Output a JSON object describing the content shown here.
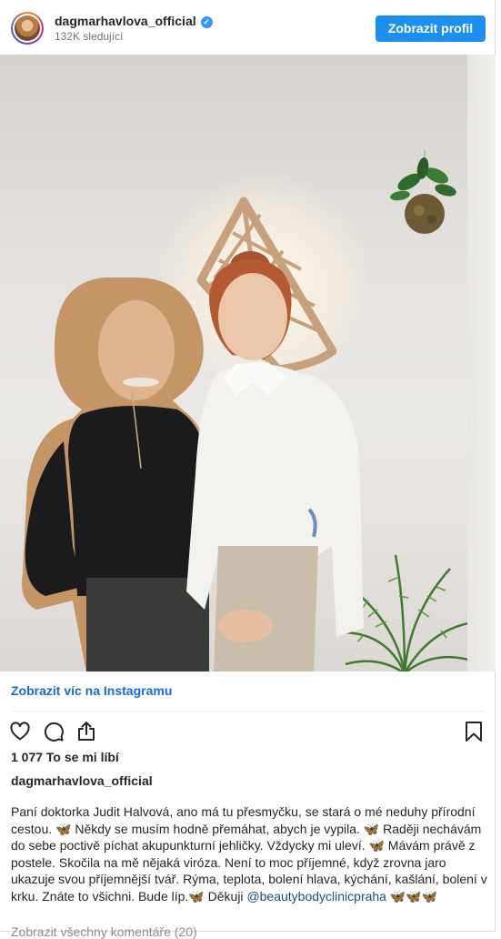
{
  "header": {
    "username": "dagmarhavlova_official",
    "followers": "132K sledující",
    "profile_button": "Zobrazit profil"
  },
  "icons": {
    "verified": "verified-badge-icon",
    "like": "heart-icon",
    "comment": "comment-icon",
    "share": "share-icon",
    "save": "bookmark-icon"
  },
  "colors": {
    "accent": "#1c8ff0",
    "link": "#1a6ad6"
  },
  "more_link": "Zobrazit víc na Instagramu",
  "likes": "1 077 To se mi líbí",
  "caption_user": "dagmarhavlova_official",
  "caption": {
    "text": "Paní doktorka Judit Halvová, ano má tu přesmyčku, se stará o mé neduhy přírodní cestou. 🦋 Někdy se musím hodně přemáhat, abych je vypila. 🦋 Raději nechávám do sebe poctivě píchat akupunkturní jehličky. Vždycky mi uleví. 🦋 Mávám právě z postele. Skočila na mě nějaká viróza. Není to moc příjemné, když zrovna jaro ukazuje svou příjemnější tvář. Rýma, teplota, bolení hlava, kýchání, kašlání, bolení v krku. Znáte to všichni. Bude líp.🦋 Děkuji",
    "mention": "@beautybodyclinicpraha",
    "emoji_tail": " 🦋🦋🦋"
  },
  "more_comments": "Zobrazit všechny komentáře (20)"
}
